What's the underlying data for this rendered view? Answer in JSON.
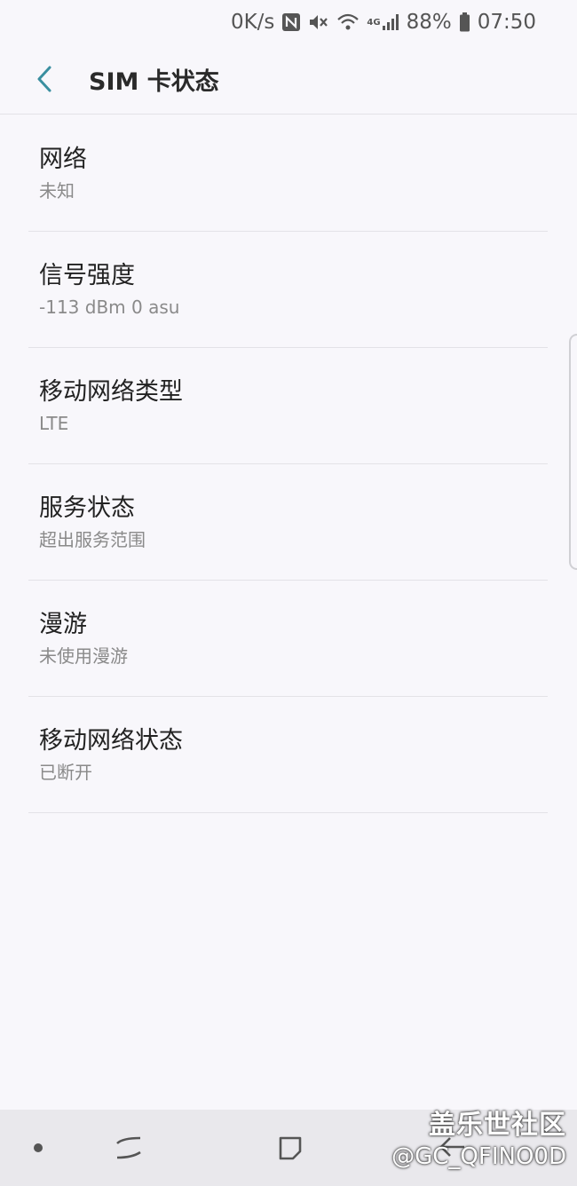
{
  "status_bar": {
    "speed": "0K/s",
    "network": "4G",
    "battery": "88%",
    "time": "07:50"
  },
  "header": {
    "title": "SIM 卡状态"
  },
  "items": [
    {
      "title": "网络",
      "value": "未知"
    },
    {
      "title": "信号强度",
      "value": "-113 dBm 0 asu"
    },
    {
      "title": "移动网络类型",
      "value": "LTE"
    },
    {
      "title": "服务状态",
      "value": "超出服务范围"
    },
    {
      "title": "漫游",
      "value": "未使用漫游"
    },
    {
      "title": "移动网络状态",
      "value": "已断开"
    }
  ],
  "watermark": {
    "line1": "盖乐世社区",
    "line2": "@GC_QFINO0D"
  },
  "colors": {
    "accent": "#3a8fa0",
    "background": "#f8f7fb",
    "nav_bar": "#e9e8ec"
  },
  "icons": [
    "nfc-icon",
    "mute-icon",
    "wifi-icon",
    "signal-icon",
    "battery-icon",
    "back-arrow-icon",
    "dot-icon",
    "recents-icon",
    "home-icon",
    "back-icon"
  ]
}
